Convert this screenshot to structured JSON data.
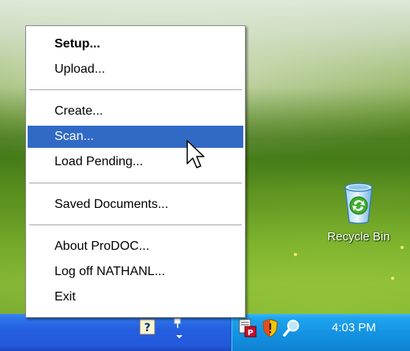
{
  "desktop": {
    "recycle_bin": {
      "label": "Recycle Bin",
      "icon": "recycle-bin-icon"
    }
  },
  "context_menu": {
    "items": [
      {
        "label": "Setup...",
        "bold": true
      },
      {
        "label": "Upload..."
      },
      {
        "label": "Create..."
      },
      {
        "label": "Scan...",
        "highlighted": true
      },
      {
        "label": "Load Pending..."
      },
      {
        "label": "Saved Documents..."
      },
      {
        "label": "About ProDOC..."
      },
      {
        "label": "Log off NATHANL..."
      },
      {
        "label": "Exit"
      }
    ],
    "highlight_color": "#316ac5"
  },
  "taskbar": {
    "tray_icons": [
      "help-icon",
      "network-icon",
      "prodoc-tray-icon",
      "security-shield-icon",
      "search-icon"
    ],
    "clock": "4:03 PM",
    "taskbar_color": "#245ee0",
    "tray_color": "#1593e3"
  }
}
